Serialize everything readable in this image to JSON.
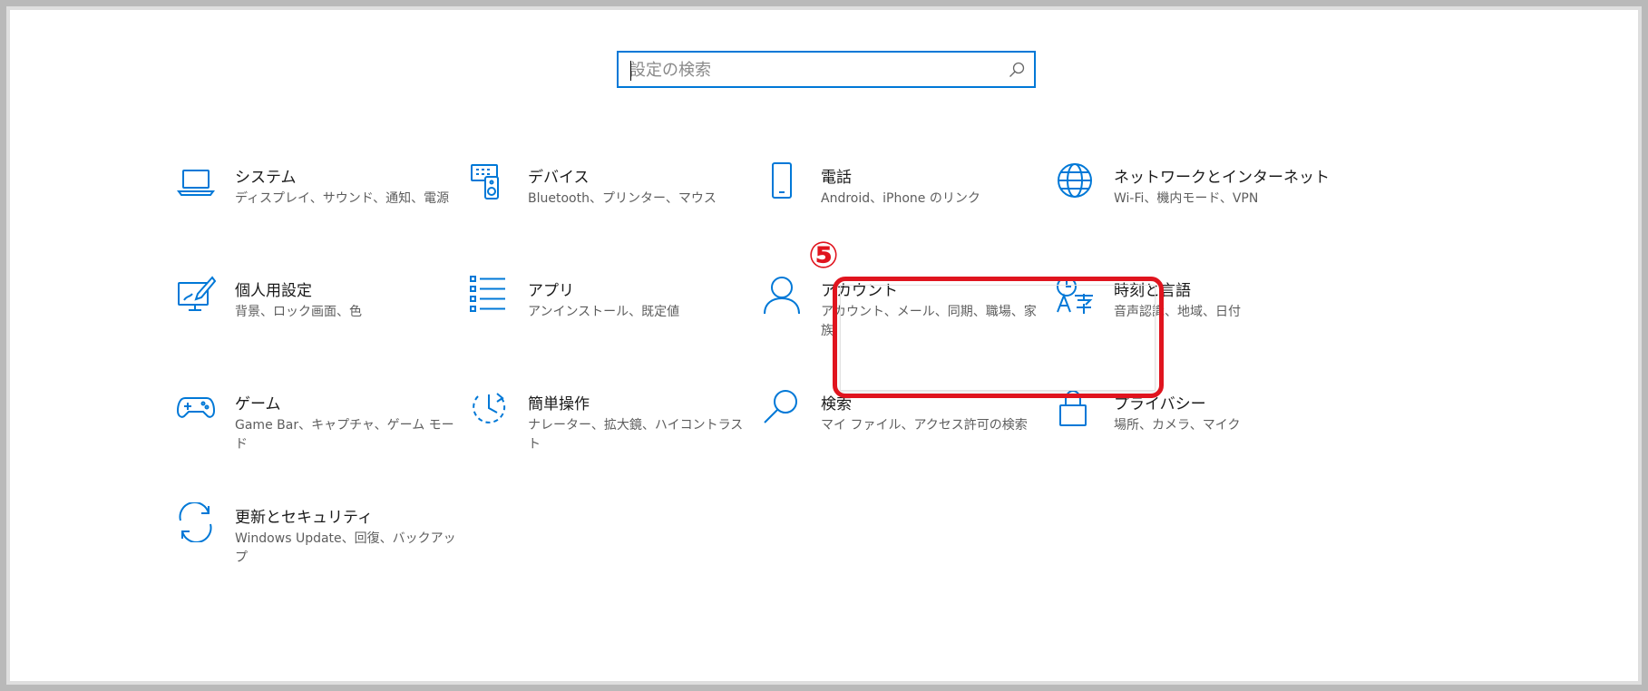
{
  "colors": {
    "accent": "#0078d7",
    "annotation": "#e0141e"
  },
  "search": {
    "placeholder": "設定の検索",
    "icon": "search-icon"
  },
  "categories": [
    {
      "key": "system",
      "label": "システム",
      "desc": "ディスプレイ、サウンド、通知、電源",
      "icon": "laptop-icon"
    },
    {
      "key": "devices",
      "label": "デバイス",
      "desc": "Bluetooth、プリンター、マウス",
      "icon": "devices-icon"
    },
    {
      "key": "phone",
      "label": "電話",
      "desc": "Android、iPhone のリンク",
      "icon": "phone-icon"
    },
    {
      "key": "network",
      "label": "ネットワークとインターネット",
      "desc": "Wi-Fi、機内モード、VPN",
      "icon": "globe-icon"
    },
    {
      "key": "personalization",
      "label": "個人用設定",
      "desc": "背景、ロック画面、色",
      "icon": "personalization-icon"
    },
    {
      "key": "apps",
      "label": "アプリ",
      "desc": "アンインストール、既定値",
      "icon": "apps-list-icon"
    },
    {
      "key": "accounts",
      "label": "アカウント",
      "desc": "アカウント、メール、同期、職場、家族",
      "icon": "person-icon"
    },
    {
      "key": "time-language",
      "label": "時刻と言語",
      "desc": "音声認識、地域、日付",
      "icon": "time-language-icon"
    },
    {
      "key": "gaming",
      "label": "ゲーム",
      "desc": "Game Bar、キャプチャ、ゲーム モード",
      "icon": "gamepad-icon"
    },
    {
      "key": "ease-of-access",
      "label": "簡単操作",
      "desc": "ナレーター、拡大鏡、ハイコントラスト",
      "icon": "ease-of-access-icon"
    },
    {
      "key": "search",
      "label": "検索",
      "desc": "マイ ファイル、アクセス許可の検索",
      "icon": "magnifier-icon"
    },
    {
      "key": "privacy",
      "label": "プライバシー",
      "desc": "場所、カメラ、マイク",
      "icon": "lock-icon"
    },
    {
      "key": "update-security",
      "label": "更新とセキュリティ",
      "desc": "Windows Update、回復、バックアップ",
      "icon": "sync-icon"
    }
  ],
  "annotation": {
    "step_marker": "⑤",
    "highlighted": "accounts"
  }
}
